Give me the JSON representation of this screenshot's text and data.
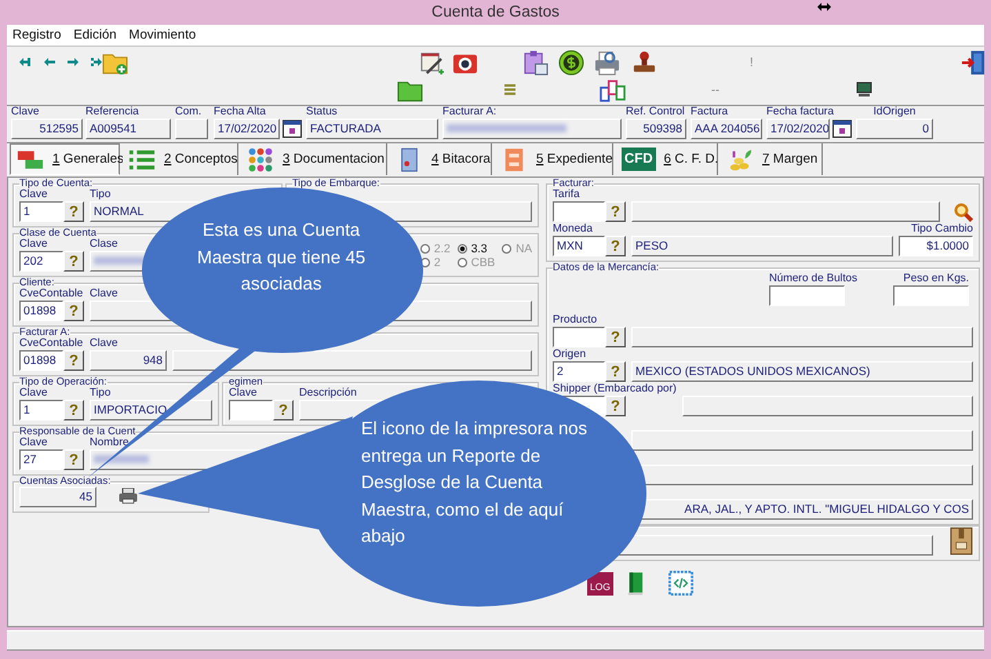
{
  "window": {
    "title": "Cuenta de Gastos"
  },
  "menu": [
    "Registro",
    "Edición",
    "Movimiento"
  ],
  "toolbar": {
    "marks": [
      "!",
      "--"
    ]
  },
  "header": [
    {
      "label": "Clave",
      "kind": "numeric",
      "value": "512595"
    },
    {
      "label": "Referencia",
      "kind": "display",
      "value": "A009541"
    },
    {
      "label": "Com.",
      "kind": "display"
    },
    {
      "label": "Fecha Alta",
      "kind": "date",
      "value": "17/02/2020"
    },
    {
      "label": "Status",
      "kind": "display",
      "value": "FACTURADA"
    },
    {
      "label": "Facturar A:",
      "kind": "redacted"
    },
    {
      "label": "Ref. Control",
      "kind": "numeric",
      "value": "509398"
    },
    {
      "label": "Factura",
      "kind": "display",
      "value": "AAA 204056"
    },
    {
      "label": "Fecha factura",
      "kind": "date",
      "value": "17/02/2020"
    },
    {
      "label": "IdOrigen",
      "kind": "numeric",
      "value": "0"
    }
  ],
  "tabs": [
    {
      "number": "1",
      "label": "Generales",
      "selected": true
    },
    {
      "number": "2",
      "label": "Conceptos",
      "selected": false
    },
    {
      "number": "3",
      "label": "Documentacion",
      "selected": false
    },
    {
      "number": "4",
      "label": "Bitacora",
      "selected": false
    },
    {
      "number": "5",
      "label": "Expediente",
      "selected": false
    },
    {
      "number": "6",
      "label": "C. F. D.",
      "icon_text": "CFD",
      "selected": false
    },
    {
      "number": "7",
      "label": "Margen",
      "selected": false
    }
  ],
  "left_rows": [
    [
      {
        "title": "Tipo de Cuenta:",
        "fields": [
          {
            "label": "Clave",
            "kind": "lookup",
            "value": "1",
            "button": "?"
          },
          {
            "label": "Tipo",
            "kind": "display",
            "value": "NORMAL"
          }
        ]
      },
      {
        "title": "Tipo de Embarque:",
        "fields": [
          {
            "kind": "display"
          }
        ]
      }
    ],
    [
      {
        "title": "Clase de Cuenta",
        "fields": [
          {
            "label": "Clave",
            "kind": "lookup",
            "value": "202",
            "button": "?"
          },
          {
            "label": "Clase",
            "kind": "redacted"
          }
        ],
        "radios": [
          {
            "label": "2.2",
            "selected": false,
            "disabled": true
          },
          {
            "label": "3.3",
            "selected": true,
            "disabled": false
          },
          {
            "label": "NA",
            "selected": false,
            "disabled": true
          },
          {
            "label": "2",
            "selected": false,
            "disabled": true
          },
          {
            "label": "CBB",
            "selected": false,
            "disabled": true
          }
        ]
      }
    ],
    [
      {
        "title": "Cliente:",
        "fields": [
          {
            "label": "CveContable",
            "kind": "lookup",
            "value": "01898",
            "button": "?"
          },
          {
            "label": "Clave",
            "kind": "display"
          }
        ]
      }
    ],
    [
      {
        "title": "Facturar A:",
        "fields": [
          {
            "label": "CveContable",
            "kind": "lookup",
            "value": "01898",
            "button": "?"
          },
          {
            "label": "Clave",
            "kind": "numeric",
            "value": "948"
          },
          {
            "kind": "display"
          }
        ]
      }
    ],
    [
      {
        "title": "Tipo de Operación:",
        "fields": [
          {
            "label": "Clave",
            "kind": "lookup",
            "value": "1",
            "button": "?"
          },
          {
            "label": "Tipo",
            "kind": "display",
            "value": "IMPORTACIO"
          }
        ]
      },
      {
        "title": "egimen",
        "fields": [
          {
            "label": "Clave",
            "kind": "lookup",
            "button": "?"
          },
          {
            "label": "Descripción",
            "kind": "display"
          }
        ]
      }
    ],
    [
      {
        "title": "Responsable de la Cuent",
        "fields": [
          {
            "label": "Clave",
            "kind": "lookup",
            "value": "27",
            "button": "?"
          },
          {
            "label": "Nombre",
            "kind": "redacted"
          }
        ]
      }
    ],
    [
      {
        "title": "Cuentas Asociadas:",
        "fields": [
          {
            "kind": "numeric",
            "value": "45"
          },
          {
            "kind": "printer"
          }
        ]
      }
    ]
  ],
  "right_groups": [
    {
      "title": "Facturar:",
      "rows": [
        [
          {
            "label": "Tarifa",
            "kind": "lookup",
            "button": "?"
          },
          {
            "kind": "display"
          },
          {
            "kind": "search"
          }
        ],
        [
          {
            "label": "Moneda",
            "kind": "lookup",
            "value": "MXN",
            "button": "?"
          },
          {
            "kind": "display",
            "value": "PESO"
          },
          {
            "label": "Tipo Cambio",
            "kind": "input",
            "value": "$1.0000"
          }
        ]
      ]
    },
    {
      "title": "Datos de la Mercancía:",
      "rows": [
        [
          {
            "label": "Número de Bultos",
            "kind": "input"
          },
          {
            "label": "Peso en Kgs.",
            "kind": "input"
          }
        ],
        [
          {
            "label": "Producto",
            "kind": "lookup",
            "button": "?"
          },
          {
            "kind": "display"
          }
        ],
        [
          {
            "label": "Origen",
            "kind": "lookup",
            "value": "2",
            "button": "?"
          },
          {
            "kind": "display",
            "value": "MEXICO (ESTADOS UNIDOS MEXICANOS)"
          }
        ],
        [
          {
            "label": "Shipper (Embarcado por)",
            "kind": "lookup",
            "button": "?"
          },
          {
            "kind": "display"
          }
        ],
        [
          {
            "kind": "display"
          }
        ],
        [
          {
            "kind": "display"
          }
        ],
        [
          {
            "kind": "clipped",
            "value": "ARA, JAL., Y APTO. INTL. \"MIGUEL HIDALGO Y COS"
          }
        ]
      ]
    },
    {
      "rows": [
        [
          {
            "kind": "display"
          },
          {
            "kind": "package"
          }
        ]
      ]
    }
  ],
  "bottom_icons": {
    "log_label": "LOG"
  },
  "callouts": [
    {
      "text": "Esta es una Cuenta\nMaestra que tiene 45\nasociadas"
    },
    {
      "text": "El icono de la impresora nos\nentrega un Reporte de\nDesglose de la Cuenta\nMaestra, como el de aquí\nabajo"
    }
  ]
}
